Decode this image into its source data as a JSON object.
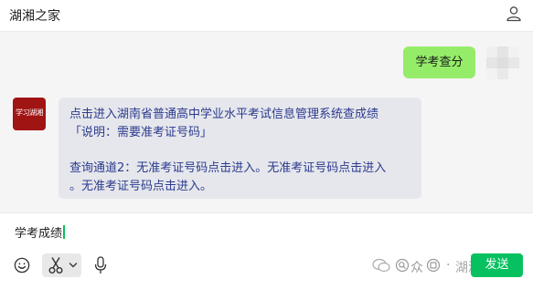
{
  "header": {
    "title": "湖湘之家",
    "profile_icon": "person-icon"
  },
  "messages": [
    {
      "from": "me",
      "text": "学考查分"
    },
    {
      "from": "bot",
      "avatar_label": "学习湖湘",
      "lines": [
        "点击进入湖南省普通高中学业水平考试信息管理系统查成绩",
        "「说明：需要准考证号码」",
        "",
        "查询通道2：无准考证号码点击进入。无准考证号码点击进入",
        "。无准考证号码点击进入。"
      ]
    }
  ],
  "input": {
    "value": "学考成绩"
  },
  "toolbar": {
    "emoji_icon": "smiley-icon",
    "cut_icon": "scissors-icon",
    "chevron_icon": "chevron-down-icon",
    "mic_icon": "microphone-icon",
    "send_label": "发送"
  },
  "watermark": {
    "text1": "众",
    "dot": "·",
    "text2": "湖湘之家"
  },
  "colors": {
    "outgoing_bubble": "#95ec69",
    "incoming_bubble": "#e6e7ec",
    "incoming_text": "#2b3a8e",
    "send_button": "#07c160",
    "bot_avatar": "#a11414"
  }
}
